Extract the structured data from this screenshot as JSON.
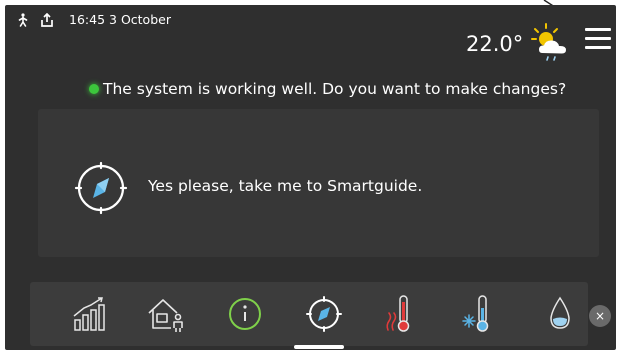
{
  "statusbar": {
    "time": "16:45",
    "date": "3 October",
    "temperature": "22.0°",
    "weather_icon": "partly-cloudy-icon",
    "menu_icon": "hamburger-menu-icon"
  },
  "status": {
    "message": "The system is working well. Do you want to make changes?",
    "color": "#3cc63c"
  },
  "card": {
    "label": "Yes please, take me to Smartguide.",
    "icon": "compass-icon"
  },
  "bottom_nav": {
    "items": [
      {
        "icon": "bar-chart-icon"
      },
      {
        "icon": "house-person-icon"
      },
      {
        "icon": "info-icon"
      },
      {
        "icon": "compass-icon",
        "active": true
      },
      {
        "icon": "heating-thermometer-icon"
      },
      {
        "icon": "cooling-thermometer-icon"
      },
      {
        "icon": "water-drop-icon"
      }
    ],
    "close_label": "×"
  },
  "colors": {
    "screen": "#2f2f2f",
    "card": "#373737",
    "bar": "#3c3c3c",
    "heat": "#e03a3a",
    "cool": "#5ab4e6",
    "ok": "#3cc63c"
  }
}
